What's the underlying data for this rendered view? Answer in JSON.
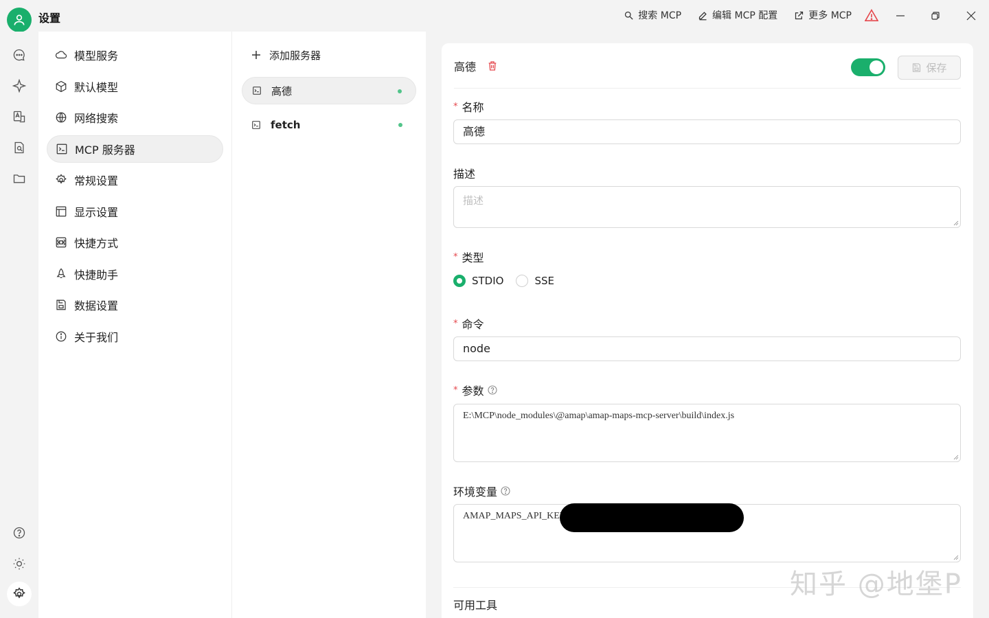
{
  "app": {
    "title": "设置"
  },
  "titlebar": {
    "search_mcp": "搜索 MCP",
    "edit_mcp_config": "编辑 MCP 配置",
    "more_mcp": "更多 MCP"
  },
  "menu": {
    "items": [
      {
        "label": "模型服务",
        "icon": "cloud-icon"
      },
      {
        "label": "默认模型",
        "icon": "cube-icon"
      },
      {
        "label": "网络搜索",
        "icon": "globe-icon"
      },
      {
        "label": "MCP 服务器",
        "icon": "terminal-icon"
      },
      {
        "label": "常规设置",
        "icon": "gear-icon"
      },
      {
        "label": "显示设置",
        "icon": "layout-icon"
      },
      {
        "label": "快捷方式",
        "icon": "command-icon"
      },
      {
        "label": "快捷助手",
        "icon": "rocket-icon"
      },
      {
        "label": "数据设置",
        "icon": "save-icon"
      },
      {
        "label": "关于我们",
        "icon": "info-icon"
      }
    ]
  },
  "servers": {
    "add_label": "添加服务器",
    "items": [
      {
        "name": "高德",
        "active": true
      },
      {
        "name": "fetch",
        "active": false
      }
    ]
  },
  "detail": {
    "server_name": "高德",
    "save_label": "保存",
    "name_label": "名称",
    "name_value": "高德",
    "desc_label": "描述",
    "desc_placeholder": "描述",
    "type_label": "类型",
    "type_options": [
      "STDIO",
      "SSE"
    ],
    "type_selected": "STDIO",
    "command_label": "命令",
    "command_value": "node",
    "args_label": "参数",
    "args_value": "E:\\MCP\\node_modules\\@amap\\amap-maps-mcp-server\\build\\index.js",
    "env_label": "环境变量",
    "env_value": "AMAP_MAPS_API_KEY=",
    "tools_label": "可用工具"
  },
  "watermark": "知乎 @地堡P",
  "colors": {
    "accent": "#1aaf6c",
    "danger": "#e5484d"
  }
}
